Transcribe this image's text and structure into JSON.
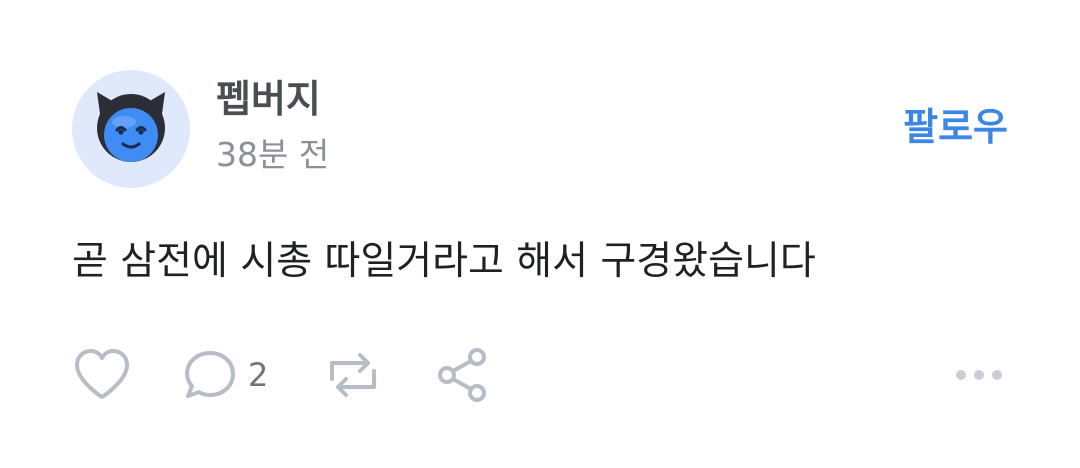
{
  "post": {
    "author": {
      "name": "펩버지",
      "avatar_icon": "blue-devil-smiley-icon"
    },
    "time": "38분 전",
    "follow_label": "팔로우",
    "body": "곧 삼전에 시총 따일거라고 해서 구경왔습니다",
    "actions": {
      "like_icon": "heart-icon",
      "comment_icon": "comment-bubble-icon",
      "comment_count": "2",
      "repost_icon": "repost-icon",
      "share_icon": "share-icon",
      "more_icon": "more-dots-icon"
    }
  },
  "colors": {
    "accent": "#3b86e6",
    "icon_gray": "#b7bdc6",
    "text_primary": "#1f2123",
    "text_secondary": "#8b9099"
  }
}
